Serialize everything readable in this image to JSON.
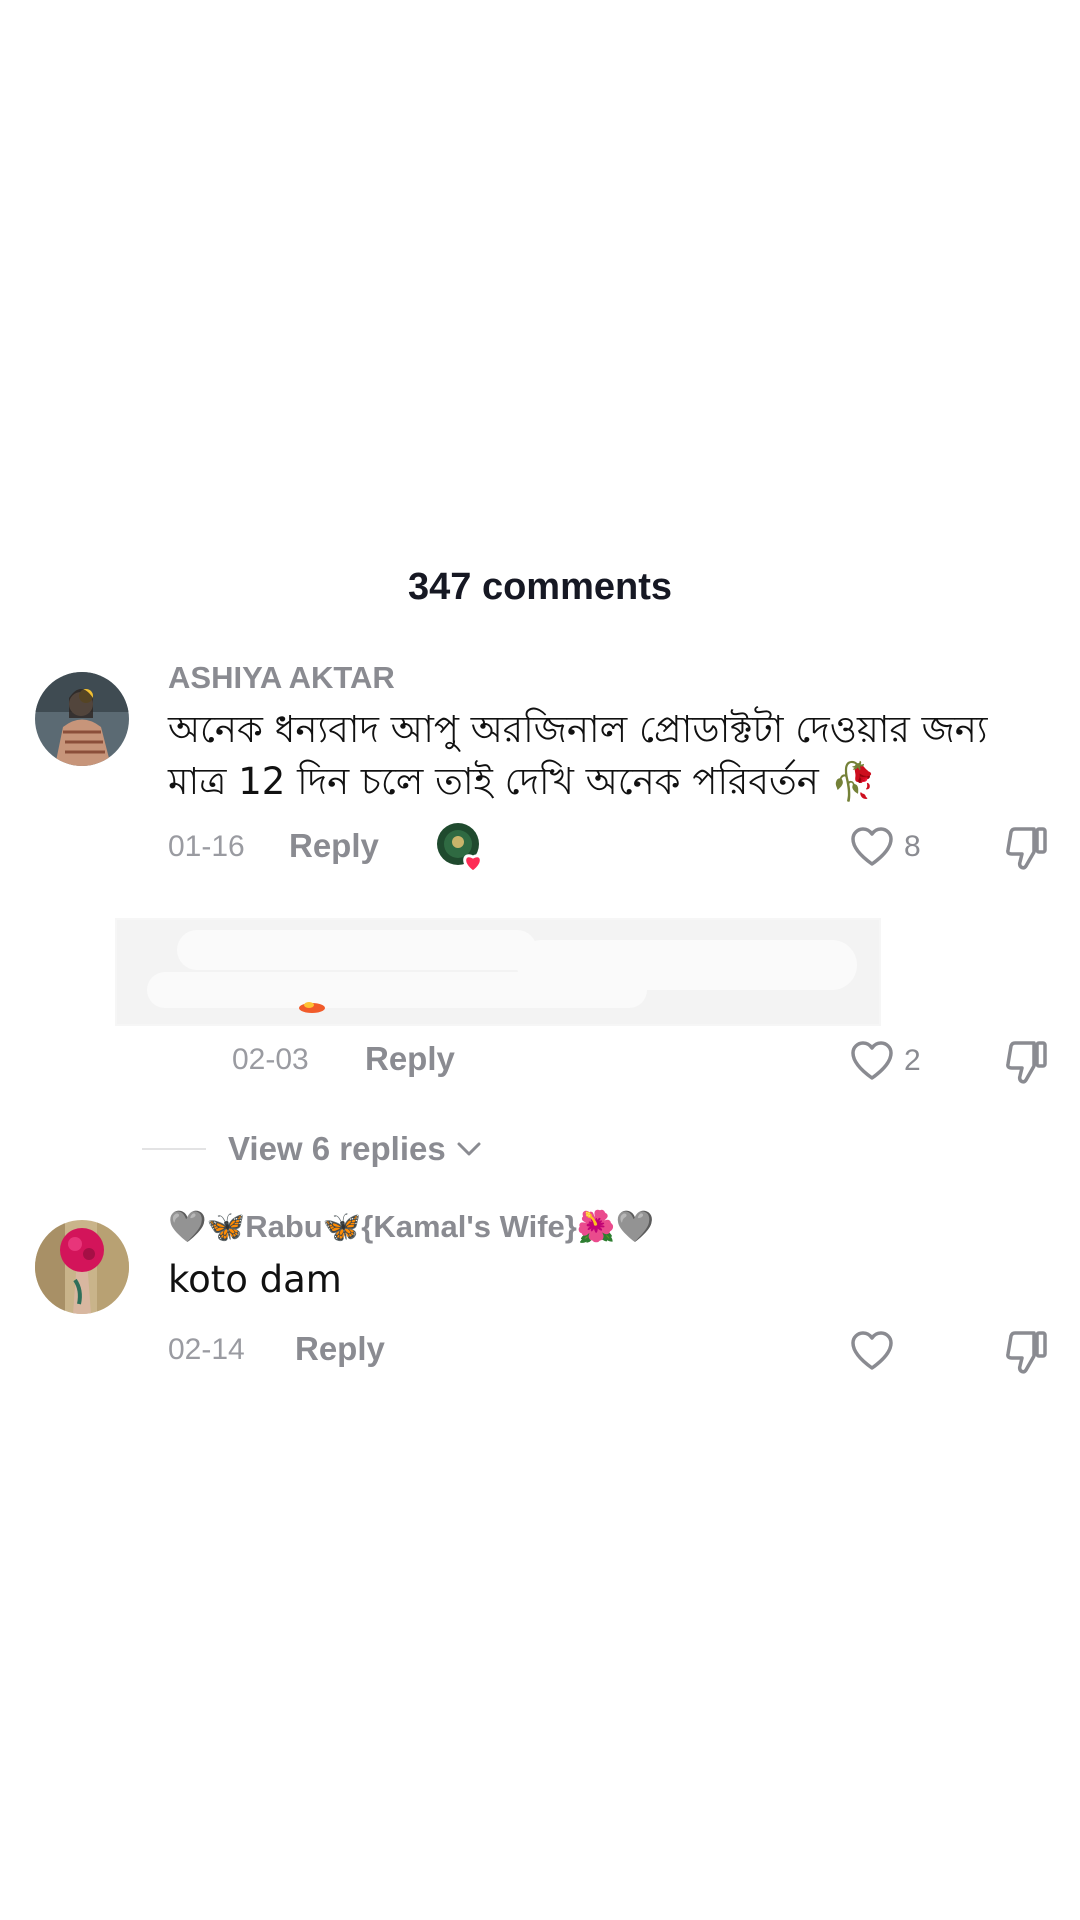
{
  "header": {
    "title": "347 comments"
  },
  "comments": [
    {
      "username": "ASHIYA AKTAR",
      "text": "অনেক ধন্যবাদ আপু অরজিনাল প্রোডাক্টটা দেওয়ার জন্য মাত্র 12 দিন চলে তাই দেখি অনেক পরিবর্তন 🥀",
      "date": "01-16",
      "reply_label": "Reply",
      "likes": "8",
      "creator_liked": true
    },
    {
      "date": "02-03",
      "reply_label": "Reply",
      "likes": "2"
    },
    {
      "username": "🩶🦋Rabu🦋{Kamal's Wife}🌺🩶",
      "text": "koto dam",
      "date": "02-14",
      "reply_label": "Reply",
      "likes": ""
    }
  ],
  "view_replies": {
    "label": "View 6 replies"
  },
  "colors": {
    "muted": "#8a8b91",
    "like_heart_badge": "#fe2c55"
  }
}
